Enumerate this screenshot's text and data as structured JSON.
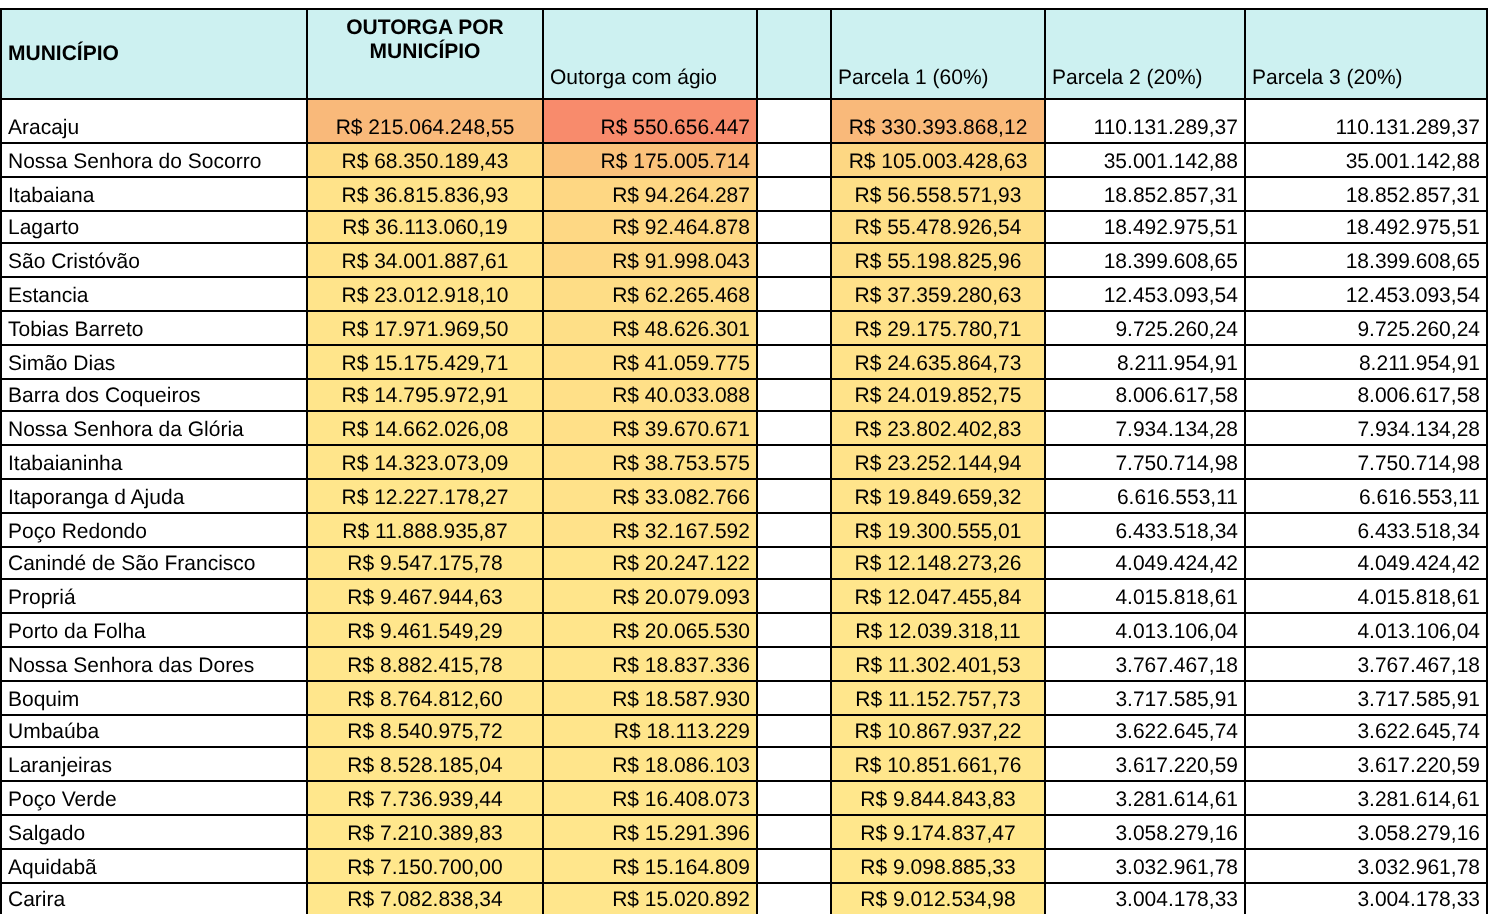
{
  "table": {
    "columns": [
      "MUNICÍPIO",
      "OUTORGA POR MUNICÍPIO",
      "Outorga com ágio",
      "Parcela 1 (60%)",
      "Parcela 2 (20%)",
      "Parcela 3 (20%)"
    ],
    "rows": [
      {
        "municipio": "Aracaju",
        "outorga": {
          "text": "R$ 215.064.248,55",
          "color": "#f9b97a"
        },
        "agio": {
          "text": "R$ 550.656.447",
          "color": "#f88b6c"
        },
        "parcela_1": {
          "text": "R$ 330.393.868,12",
          "color": "#f9b97a"
        },
        "parcela_2": "110.131.289,37",
        "parcela_3": "110.131.289,37"
      },
      {
        "municipio": "Nossa Senhora do Socorro",
        "outorga": {
          "text": "R$ 68.350.189,43",
          "color": "#fedd85"
        },
        "agio": {
          "text": "R$ 175.005.714",
          "color": "#fbc27b"
        },
        "parcela_1": {
          "text": "R$ 105.003.428,63",
          "color": "#fdd783"
        },
        "parcela_2": "35.001.142,88",
        "parcela_3": "35.001.142,88"
      },
      {
        "municipio": "Itabaiana",
        "outorga": {
          "text": "R$ 36.815.836,93",
          "color": "#ffe38a"
        },
        "agio": {
          "text": "R$ 94.264.287",
          "color": "#fed783"
        },
        "parcela_1": {
          "text": "R$ 56.558.571,93",
          "color": "#fedf87"
        },
        "parcela_2": "18.852.857,31",
        "parcela_3": "18.852.857,31"
      },
      {
        "municipio": "Lagarto",
        "outorga": {
          "text": "R$ 36.113.060,19",
          "color": "#ffe38a"
        },
        "agio": {
          "text": "R$ 92.464.878",
          "color": "#fed884"
        },
        "parcela_1": {
          "text": "R$ 55.478.926,54",
          "color": "#fedf87"
        },
        "parcela_2": "18.492.975,51",
        "parcela_3": "18.492.975,51"
      },
      {
        "municipio": "São Cristóvão",
        "outorga": {
          "text": "R$ 34.001.887,61",
          "color": "#ffe38a"
        },
        "agio": {
          "text": "R$ 91.998.043",
          "color": "#fed884"
        },
        "parcela_1": {
          "text": "R$ 55.198.825,96",
          "color": "#fedf87"
        },
        "parcela_2": "18.399.608,65",
        "parcela_3": "18.399.608,65"
      },
      {
        "municipio": "Estancia",
        "outorga": {
          "text": "R$ 23.012.918,10",
          "color": "#ffe48b"
        },
        "agio": {
          "text": "R$ 62.265.468",
          "color": "#fedd86"
        },
        "parcela_1": {
          "text": "R$ 37.359.280,63",
          "color": "#ffe189"
        },
        "parcela_2": "12.453.093,54",
        "parcela_3": "12.453.093,54"
      },
      {
        "municipio": "Tobias Barreto",
        "outorga": {
          "text": "R$ 17.971.969,50",
          "color": "#ffe48b"
        },
        "agio": {
          "text": "R$ 48.626.301",
          "color": "#fedf87"
        },
        "parcela_1": {
          "text": "R$ 29.175.780,71",
          "color": "#ffe28a"
        },
        "parcela_2": "9.725.260,24",
        "parcela_3": "9.725.260,24"
      },
      {
        "municipio": "Simão Dias",
        "outorga": {
          "text": "R$ 15.175.429,71",
          "color": "#ffe58b"
        },
        "agio": {
          "text": "R$ 41.059.775",
          "color": "#ffe088"
        },
        "parcela_1": {
          "text": "R$ 24.635.864,73",
          "color": "#ffe38a"
        },
        "parcela_2": "8.211.954,91",
        "parcela_3": "8.211.954,91"
      },
      {
        "municipio": "Barra dos Coqueiros",
        "outorga": {
          "text": "R$ 14.795.972,91",
          "color": "#ffe58b"
        },
        "agio": {
          "text": "R$ 40.033.088",
          "color": "#ffe088"
        },
        "parcela_1": {
          "text": "R$ 24.019.852,75",
          "color": "#ffe38a"
        },
        "parcela_2": "8.006.617,58",
        "parcela_3": "8.006.617,58"
      },
      {
        "municipio": "Nossa Senhora da Glória",
        "outorga": {
          "text": "R$ 14.662.026,08",
          "color": "#ffe58b"
        },
        "agio": {
          "text": "R$ 39.670.671",
          "color": "#ffe088"
        },
        "parcela_1": {
          "text": "R$ 23.802.402,83",
          "color": "#ffe38a"
        },
        "parcela_2": "7.934.134,28",
        "parcela_3": "7.934.134,28"
      },
      {
        "municipio": "Itabaianinha",
        "outorga": {
          "text": "R$ 14.323.073,09",
          "color": "#ffe58b"
        },
        "agio": {
          "text": "R$ 38.753.575",
          "color": "#ffe189"
        },
        "parcela_1": {
          "text": "R$ 23.252.144,94",
          "color": "#ffe38a"
        },
        "parcela_2": "7.750.714,98",
        "parcela_3": "7.750.714,98"
      },
      {
        "municipio": "Itaporanga d Ajuda",
        "outorga": {
          "text": "R$ 12.227.178,27",
          "color": "#ffe68c"
        },
        "agio": {
          "text": "R$ 33.082.766",
          "color": "#ffe28a"
        },
        "parcela_1": {
          "text": "R$ 19.849.659,32",
          "color": "#ffe48b"
        },
        "parcela_2": "6.616.553,11",
        "parcela_3": "6.616.553,11"
      },
      {
        "municipio": "Poço Redondo",
        "outorga": {
          "text": "R$ 11.888.935,87",
          "color": "#ffe68c"
        },
        "agio": {
          "text": "R$ 32.167.592",
          "color": "#ffe28a"
        },
        "parcela_1": {
          "text": "R$ 19.300.555,01",
          "color": "#ffe48b"
        },
        "parcela_2": "6.433.518,34",
        "parcela_3": "6.433.518,34"
      },
      {
        "municipio": "Canindé de São Francisco",
        "outorga": {
          "text": "R$ 9.547.175,78",
          "color": "#ffe68c"
        },
        "agio": {
          "text": "R$ 20.247.122",
          "color": "#ffe58b"
        },
        "parcela_1": {
          "text": "R$ 12.148.273,26",
          "color": "#ffe68c"
        },
        "parcela_2": "4.049.424,42",
        "parcela_3": "4.049.424,42"
      },
      {
        "municipio": "Propriá",
        "outorga": {
          "text": "R$ 9.467.944,63",
          "color": "#ffe68c"
        },
        "agio": {
          "text": "R$ 20.079.093",
          "color": "#ffe58b"
        },
        "parcela_1": {
          "text": "R$ 12.047.455,84",
          "color": "#ffe68c"
        },
        "parcela_2": "4.015.818,61",
        "parcela_3": "4.015.818,61"
      },
      {
        "municipio": "Porto da Folha",
        "outorga": {
          "text": "R$ 9.461.549,29",
          "color": "#ffe68c"
        },
        "agio": {
          "text": "R$ 20.065.530",
          "color": "#ffe58b"
        },
        "parcela_1": {
          "text": "R$ 12.039.318,11",
          "color": "#ffe68c"
        },
        "parcela_2": "4.013.106,04",
        "parcela_3": "4.013.106,04"
      },
      {
        "municipio": "Nossa Senhora das Dores",
        "outorga": {
          "text": "R$ 8.882.415,78",
          "color": "#ffe68c"
        },
        "agio": {
          "text": "R$ 18.837.336",
          "color": "#ffe58b"
        },
        "parcela_1": {
          "text": "R$ 11.302.401,53",
          "color": "#ffe68c"
        },
        "parcela_2": "3.767.467,18",
        "parcela_3": "3.767.467,18"
      },
      {
        "municipio": "Boquim",
        "outorga": {
          "text": "R$ 8.764.812,60",
          "color": "#ffe68c"
        },
        "agio": {
          "text": "R$ 18.587.930",
          "color": "#ffe58b"
        },
        "parcela_1": {
          "text": "R$ 11.152.757,73",
          "color": "#ffe68c"
        },
        "parcela_2": "3.717.585,91",
        "parcela_3": "3.717.585,91"
      },
      {
        "municipio": "Umbaúba",
        "outorga": {
          "text": "R$ 8.540.975,72",
          "color": "#ffe68c"
        },
        "agio": {
          "text": "R$ 18.113.229",
          "color": "#ffe58b"
        },
        "parcela_1": {
          "text": "R$ 10.867.937,22",
          "color": "#ffe68c"
        },
        "parcela_2": "3.622.645,74",
        "parcela_3": "3.622.645,74"
      },
      {
        "municipio": "Laranjeiras",
        "outorga": {
          "text": "R$ 8.528.185,04",
          "color": "#ffe68c"
        },
        "agio": {
          "text": "R$ 18.086.103",
          "color": "#ffe58b"
        },
        "parcela_1": {
          "text": "R$ 10.851.661,76",
          "color": "#ffe68c"
        },
        "parcela_2": "3.617.220,59",
        "parcela_3": "3.617.220,59"
      },
      {
        "municipio": "Poço Verde",
        "outorga": {
          "text": "R$ 7.736.939,44",
          "color": "#ffe78c"
        },
        "agio": {
          "text": "R$ 16.408.073",
          "color": "#ffe68c"
        },
        "parcela_1": {
          "text": "R$ 9.844.843,83",
          "color": "#ffe78c"
        },
        "parcela_2": "3.281.614,61",
        "parcela_3": "3.281.614,61"
      },
      {
        "municipio": "Salgado",
        "outorga": {
          "text": "R$ 7.210.389,83",
          "color": "#ffe78c"
        },
        "agio": {
          "text": "R$ 15.291.396",
          "color": "#ffe68c"
        },
        "parcela_1": {
          "text": "R$ 9.174.837,47",
          "color": "#ffe78c"
        },
        "parcela_2": "3.058.279,16",
        "parcela_3": "3.058.279,16"
      },
      {
        "municipio": "Aquidabã",
        "outorga": {
          "text": "R$ 7.150.700,00",
          "color": "#ffe78c"
        },
        "agio": {
          "text": "R$ 15.164.809",
          "color": "#ffe68c"
        },
        "parcela_1": {
          "text": "R$ 9.098.885,33",
          "color": "#ffe78c"
        },
        "parcela_2": "3.032.961,78",
        "parcela_3": "3.032.961,78"
      },
      {
        "municipio": "Carira",
        "outorga": {
          "text": "R$ 7.082.838,34",
          "color": "#ffe78c"
        },
        "agio": {
          "text": "R$ 15.020.892",
          "color": "#ffe68c"
        },
        "parcela_1": {
          "text": "R$ 9.012.534,98",
          "color": "#ffe78c"
        },
        "parcela_2": "3.004.178,33",
        "parcela_3": "3.004.178,33"
      }
    ]
  }
}
